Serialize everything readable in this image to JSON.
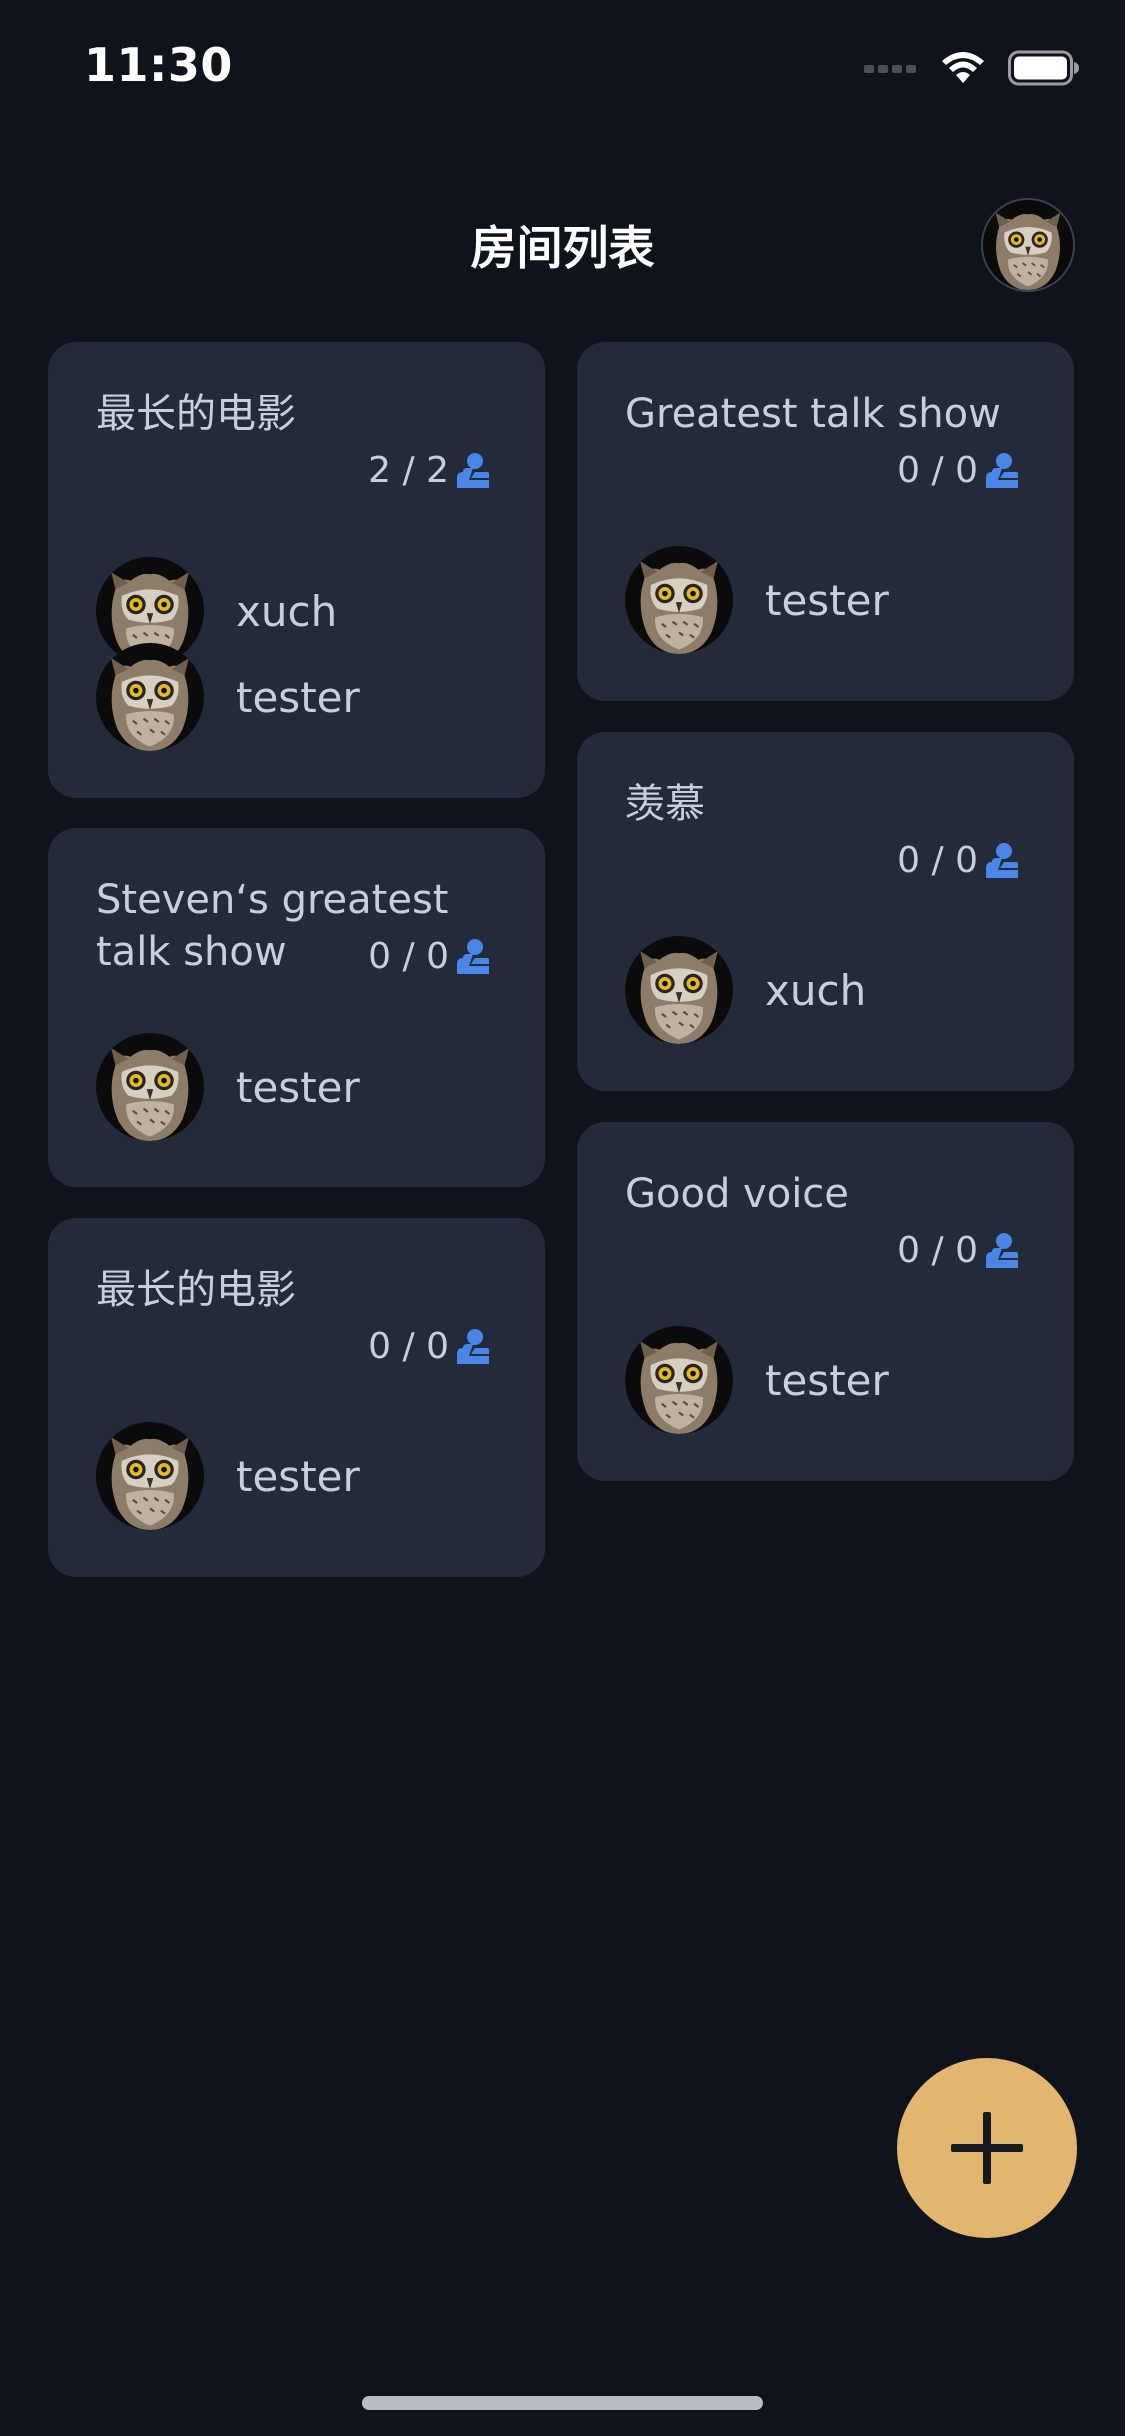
{
  "status_bar": {
    "time": "11:30"
  },
  "header": {
    "title": "房间列表",
    "avatar_icon": "owl-avatar"
  },
  "rooms": [
    {
      "title": "最长的电影",
      "count": "2 / 2",
      "members": [
        {
          "name": "xuch",
          "avatar": "owl-avatar"
        },
        {
          "name": "tester",
          "avatar": "owl-avatar"
        }
      ]
    },
    {
      "title": "Greatest talk show",
      "count": "0 / 0",
      "members": [
        {
          "name": "tester",
          "avatar": "owl-avatar"
        }
      ]
    },
    {
      "title": "Steven‘s greatest talk show",
      "count": "0 / 0",
      "members": [
        {
          "name": "tester",
          "avatar": "owl-avatar"
        }
      ]
    },
    {
      "title": "羡慕",
      "count": "0 / 0",
      "members": [
        {
          "name": "xuch",
          "avatar": "owl-avatar"
        }
      ]
    },
    {
      "title": "最长的电影",
      "count": "0 / 0",
      "members": [
        {
          "name": "tester",
          "avatar": "owl-avatar"
        }
      ]
    },
    {
      "title": "Good voice",
      "count": "0 / 0",
      "members": [
        {
          "name": "tester",
          "avatar": "owl-avatar"
        }
      ]
    }
  ],
  "fab": {
    "icon": "plus-icon"
  },
  "colors": {
    "background": "#0f131b",
    "card": "#232b3b",
    "accent": "#e3b66f",
    "count_icon": "#4a86e8"
  }
}
